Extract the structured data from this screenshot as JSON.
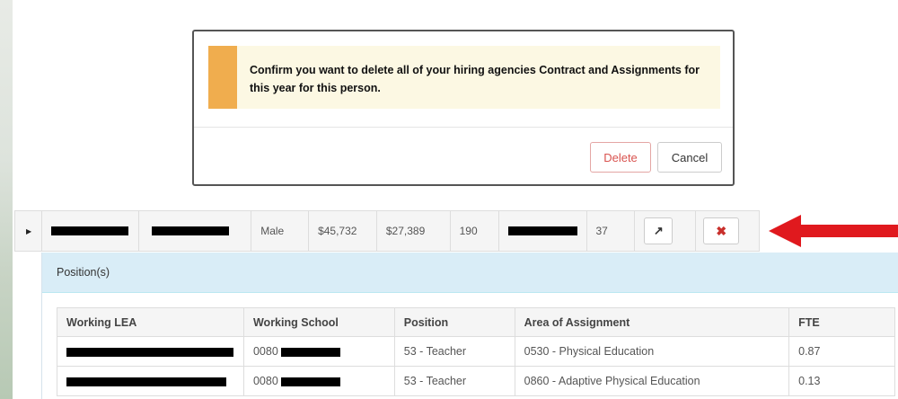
{
  "modal": {
    "message": "Confirm you want to delete all of your hiring agencies Contract and Assignments for this year for this person.",
    "delete_label": "Delete",
    "cancel_label": "Cancel",
    "colors": {
      "warning_bar": "#f0ad4e",
      "warning_bg": "#fcf8e3",
      "danger": "#d9534f"
    }
  },
  "main_row": {
    "expand_icon": "triangle-right-icon",
    "gender": "Male",
    "salary_1": "$45,732",
    "salary_2": "$27,389",
    "days": "190",
    "number": "37",
    "edit_icon": "edit-icon",
    "delete_icon": "close-icon"
  },
  "annotation": {
    "arrow_color": "#e0191e",
    "arrow_icon": "arrow-left-icon"
  },
  "positions": {
    "heading": "Position(s)",
    "columns": [
      "Working LEA",
      "Working School",
      "Position",
      "Area of Assignment",
      "FTE"
    ],
    "rows": [
      {
        "school_code": "0080",
        "position": "53 - Teacher",
        "area": "0530 - Physical Education",
        "fte": "0.87"
      },
      {
        "school_code": "0080",
        "position": "53 - Teacher",
        "area": "0860 - Adaptive Physical Education",
        "fte": "0.13"
      }
    ]
  }
}
